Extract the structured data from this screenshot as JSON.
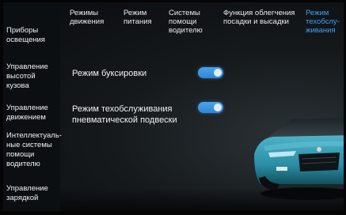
{
  "sidebar": {
    "items": [
      {
        "label": "Приборы освещения"
      },
      {
        "label": "Управление высотой кузова"
      },
      {
        "label": "Управление движением"
      },
      {
        "label": "Интеллектуаль-ные системы помощи водителю"
      },
      {
        "label": "Управление зарядкой"
      }
    ]
  },
  "tabs": [
    {
      "label": "Режимы движения"
    },
    {
      "label": "Режим питания"
    },
    {
      "label": "Системы помощи водителю"
    },
    {
      "label": "Функция облегчения посадки и высадки"
    },
    {
      "label": "Режим техобслу-живания",
      "active": true
    }
  ],
  "settings": [
    {
      "label": "Режим буксировки",
      "enabled": true
    },
    {
      "label": "Режим техобслуживания пневматической подвески",
      "enabled": true
    }
  ],
  "colors": {
    "accent": "#3fa0f0",
    "toggle_on": "#3b92dd",
    "car_body": "#2f8fa6"
  },
  "car": {
    "icon": "car-illustration"
  }
}
